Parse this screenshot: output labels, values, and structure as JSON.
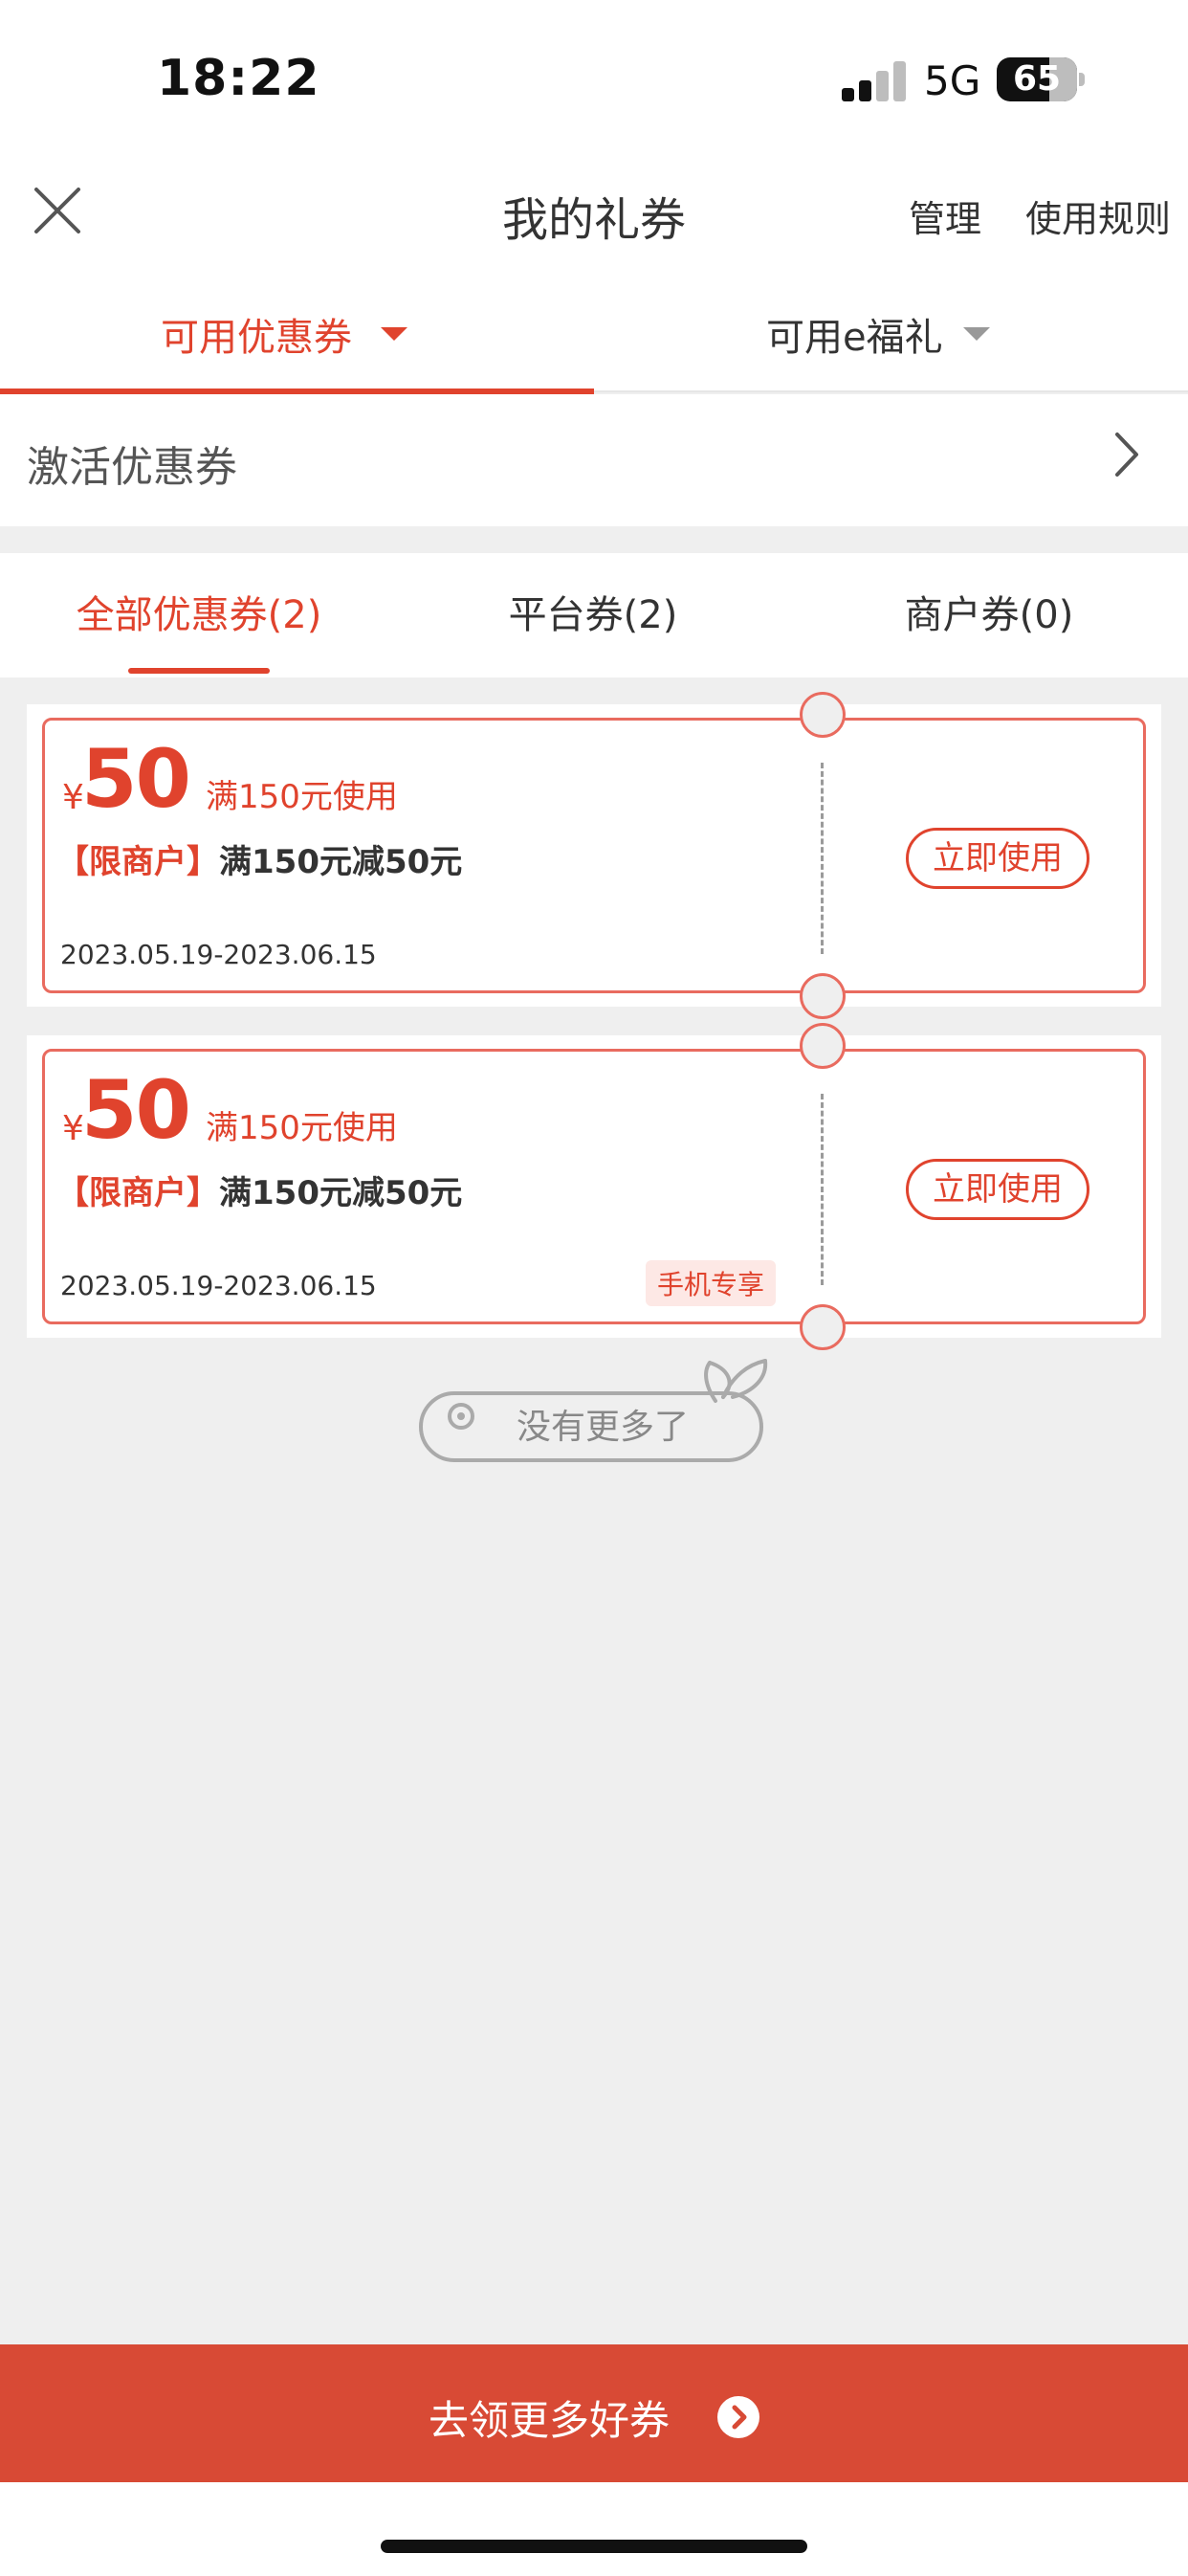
{
  "status_bar": {
    "time": "18:22",
    "network": "5G",
    "battery": "65",
    "battery_fraction": 0.65
  },
  "nav": {
    "title": "我的礼券",
    "manage": "管理",
    "rules": "使用规则",
    "close_icon": "close-icon"
  },
  "top_tabs": [
    {
      "label": "可用优惠券",
      "active": true
    },
    {
      "label": "可用e福礼",
      "active": false
    }
  ],
  "activate": {
    "label": "激活优惠券",
    "icon": "chevron-right-icon"
  },
  "sub_tabs": [
    {
      "label": "全部优惠券(2)",
      "active": true
    },
    {
      "label": "平台券(2)",
      "active": false
    },
    {
      "label": "商户券(0)",
      "active": false
    }
  ],
  "coupons": [
    {
      "currency": "¥",
      "amount": "50",
      "condition": "满150元使用",
      "tag": "【限商户】",
      "title": "满150元减50元",
      "dates": "2023.05.19-2023.06.15",
      "badge": "",
      "action": "立即使用"
    },
    {
      "currency": "¥",
      "amount": "50",
      "condition": "满150元使用",
      "tag": "【限商户】",
      "title": "满150元减50元",
      "dates": "2023.05.19-2023.06.15",
      "badge": "手机专享",
      "action": "立即使用"
    }
  ],
  "end_text": "没有更多了",
  "cta": {
    "label": "去领更多好券",
    "icon": "arrow-right-circle-icon"
  },
  "colors": {
    "accent": "#e0432d",
    "cta_bg": "#d84a35",
    "coupon_border": "#e96b5f",
    "page_bg": "#efefef"
  }
}
